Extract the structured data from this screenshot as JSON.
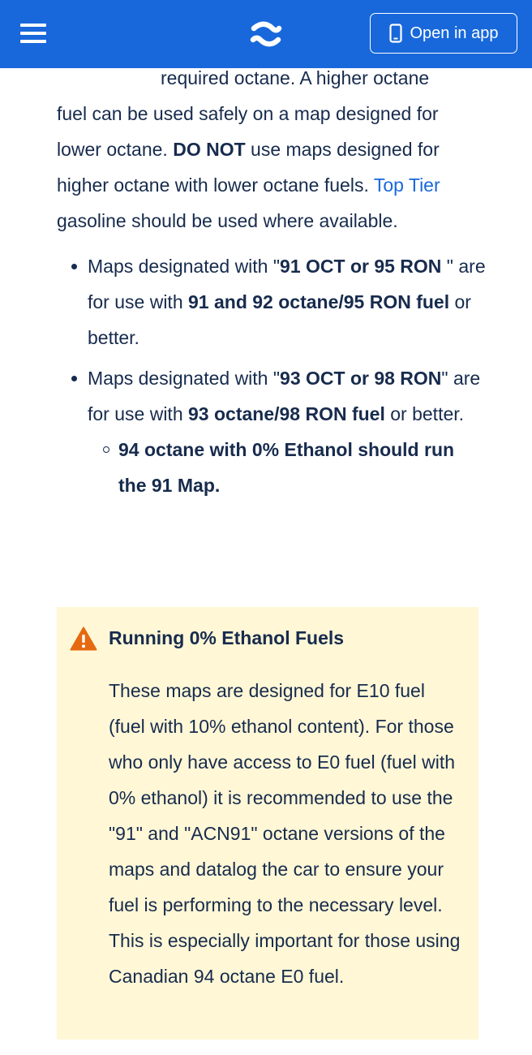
{
  "header": {
    "open_in_app_label": "Open in app",
    "background_color": "#1868db"
  },
  "article": {
    "para_line1": "required octane. A higher octane",
    "para_text1": "fuel can be used safely on a map designed for lower octane. ",
    "para_bold1": "DO NOT",
    "para_text2": " use maps designed for higher octane with lower octane fuels. ",
    "para_link": "Top Tier",
    "para_text3": " gasoline should be used where available.",
    "bullet1": {
      "t1": "Maps designated with \"",
      "b1": "91 OCT or 95 RON",
      "t2": " \" are for use with ",
      "b2": "91 and 92 octane/95 RON fuel",
      "t3": " or better."
    },
    "bullet2": {
      "t1": "Maps designated with \"",
      "b1": "93 OCT or 98 RON",
      "t2": "\" are for use with ",
      "b2": "93 octane/98 RON fuel",
      "t3": " or better."
    },
    "sub_bullet": "94 octane with 0% Ethanol should run the 91 Map."
  },
  "warning_panel": {
    "title": "Running 0% Ethanol Fuels",
    "body": "These maps are designed for E10 fuel (fuel with 10% ethanol content). For those who only have access to E0 fuel (fuel with 0% ethanol) it is recommended to use the \"91\" and \"ACN91\" octane versions of the maps and datalog the car to ensure your fuel is performing to the necessary level. This is especially important for those using Canadian 94 octane E0 fuel.",
    "background_color": "#fff7d6",
    "icon_color": "#e56910"
  }
}
